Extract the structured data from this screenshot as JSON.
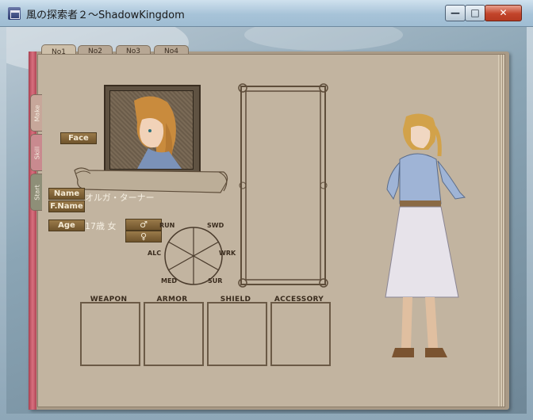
{
  "window": {
    "title": "風の探索者２～ShadowKingdom",
    "min_glyph": "—",
    "max_glyph": "□",
    "close_glyph": "✕"
  },
  "top_tabs": [
    "No1",
    "No2",
    "No3",
    "No4"
  ],
  "side_tabs": [
    "Make",
    "Skill",
    "Start"
  ],
  "buttons": {
    "face": "Face",
    "male": "♂",
    "female": "♀"
  },
  "fields": {
    "name_label": "Name",
    "fname_label": "F.Name",
    "name_value": "オルガ・ターナー",
    "age_label": "Age",
    "age_value": "17歳 女"
  },
  "stats": [
    "RUN",
    "SWD",
    "ALC",
    "WRK",
    "MED",
    "SUR"
  ],
  "equipment": [
    "WEAPON",
    "ARMOR",
    "SHIELD",
    "ACCESSORY"
  ],
  "colors": {
    "page": "#c2b4a0",
    "plaque": "#7d6236",
    "spine": "#c0586a",
    "ink": "#4a3b2c"
  }
}
